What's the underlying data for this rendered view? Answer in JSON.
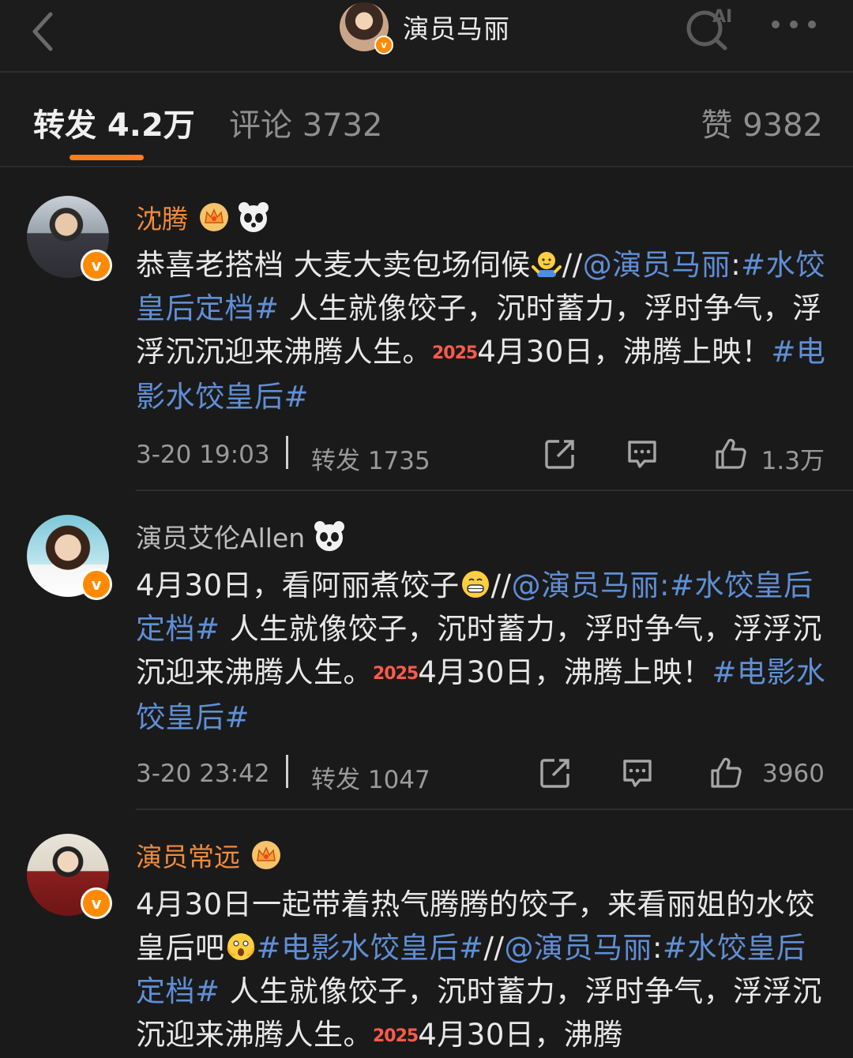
{
  "header": {
    "title": "演员马丽",
    "badge": "v"
  },
  "tabs": {
    "repost": "转发 4.2万",
    "comment": "评论 3732",
    "like": "赞 9382"
  },
  "posts": [
    {
      "name": "沈腾",
      "segments": [
        {
          "t": "恭喜老搭档 大麦大卖包场伺候"
        },
        {
          "t": "//"
        },
        {
          "t": "@演员马丽",
          "link": true
        },
        {
          "t": ":"
        },
        {
          "t": "#水饺皇后定档#",
          "link": true
        },
        {
          "t": " 人生就像饺子，沉时蓄力，浮时争气，浮浮沉沉迎来沸腾人生。"
        },
        {
          "badge": "2025"
        },
        {
          "t": "4月30日，沸腾上映！"
        },
        {
          "t": "#电影水饺皇后#",
          "link": true
        }
      ],
      "time": "3-20 19:03",
      "reposts": "转发 1735",
      "likes": "1.3万"
    },
    {
      "name": "演员艾伦Allen",
      "segments": [
        {
          "t": "4月30日，看阿丽煮饺子"
        },
        {
          "t": "//"
        },
        {
          "t": "@演员马丽:",
          "link": true
        },
        {
          "t": "#水饺皇后定档#",
          "link": true
        },
        {
          "t": " 人生就像饺子，沉时蓄力，浮时争气，浮浮沉沉迎来沸腾人生。"
        },
        {
          "badge": "2025"
        },
        {
          "t": "4月30日，沸腾上映！"
        },
        {
          "t": "#电影水饺皇后#",
          "link": true
        }
      ],
      "time": "3-20 23:42",
      "reposts": "转发 1047",
      "likes": "3960"
    },
    {
      "name": "演员常远",
      "segments": [
        {
          "t": "4月30日一起带着热气腾腾的饺子，来看丽姐的水饺皇后吧"
        },
        {
          "t": "#电影水饺皇后#",
          "link": true
        },
        {
          "t": "//"
        },
        {
          "t": "@演员马丽",
          "link": true
        },
        {
          "t": ":"
        },
        {
          "t": "#水饺皇后定档#",
          "link": true
        },
        {
          "t": " 人生就像饺子，沉时蓄力，浮时争气，浮浮沉沉迎来沸腾人生。"
        },
        {
          "badge": "2025"
        },
        {
          "t": "4月30日，沸腾"
        }
      ]
    }
  ]
}
